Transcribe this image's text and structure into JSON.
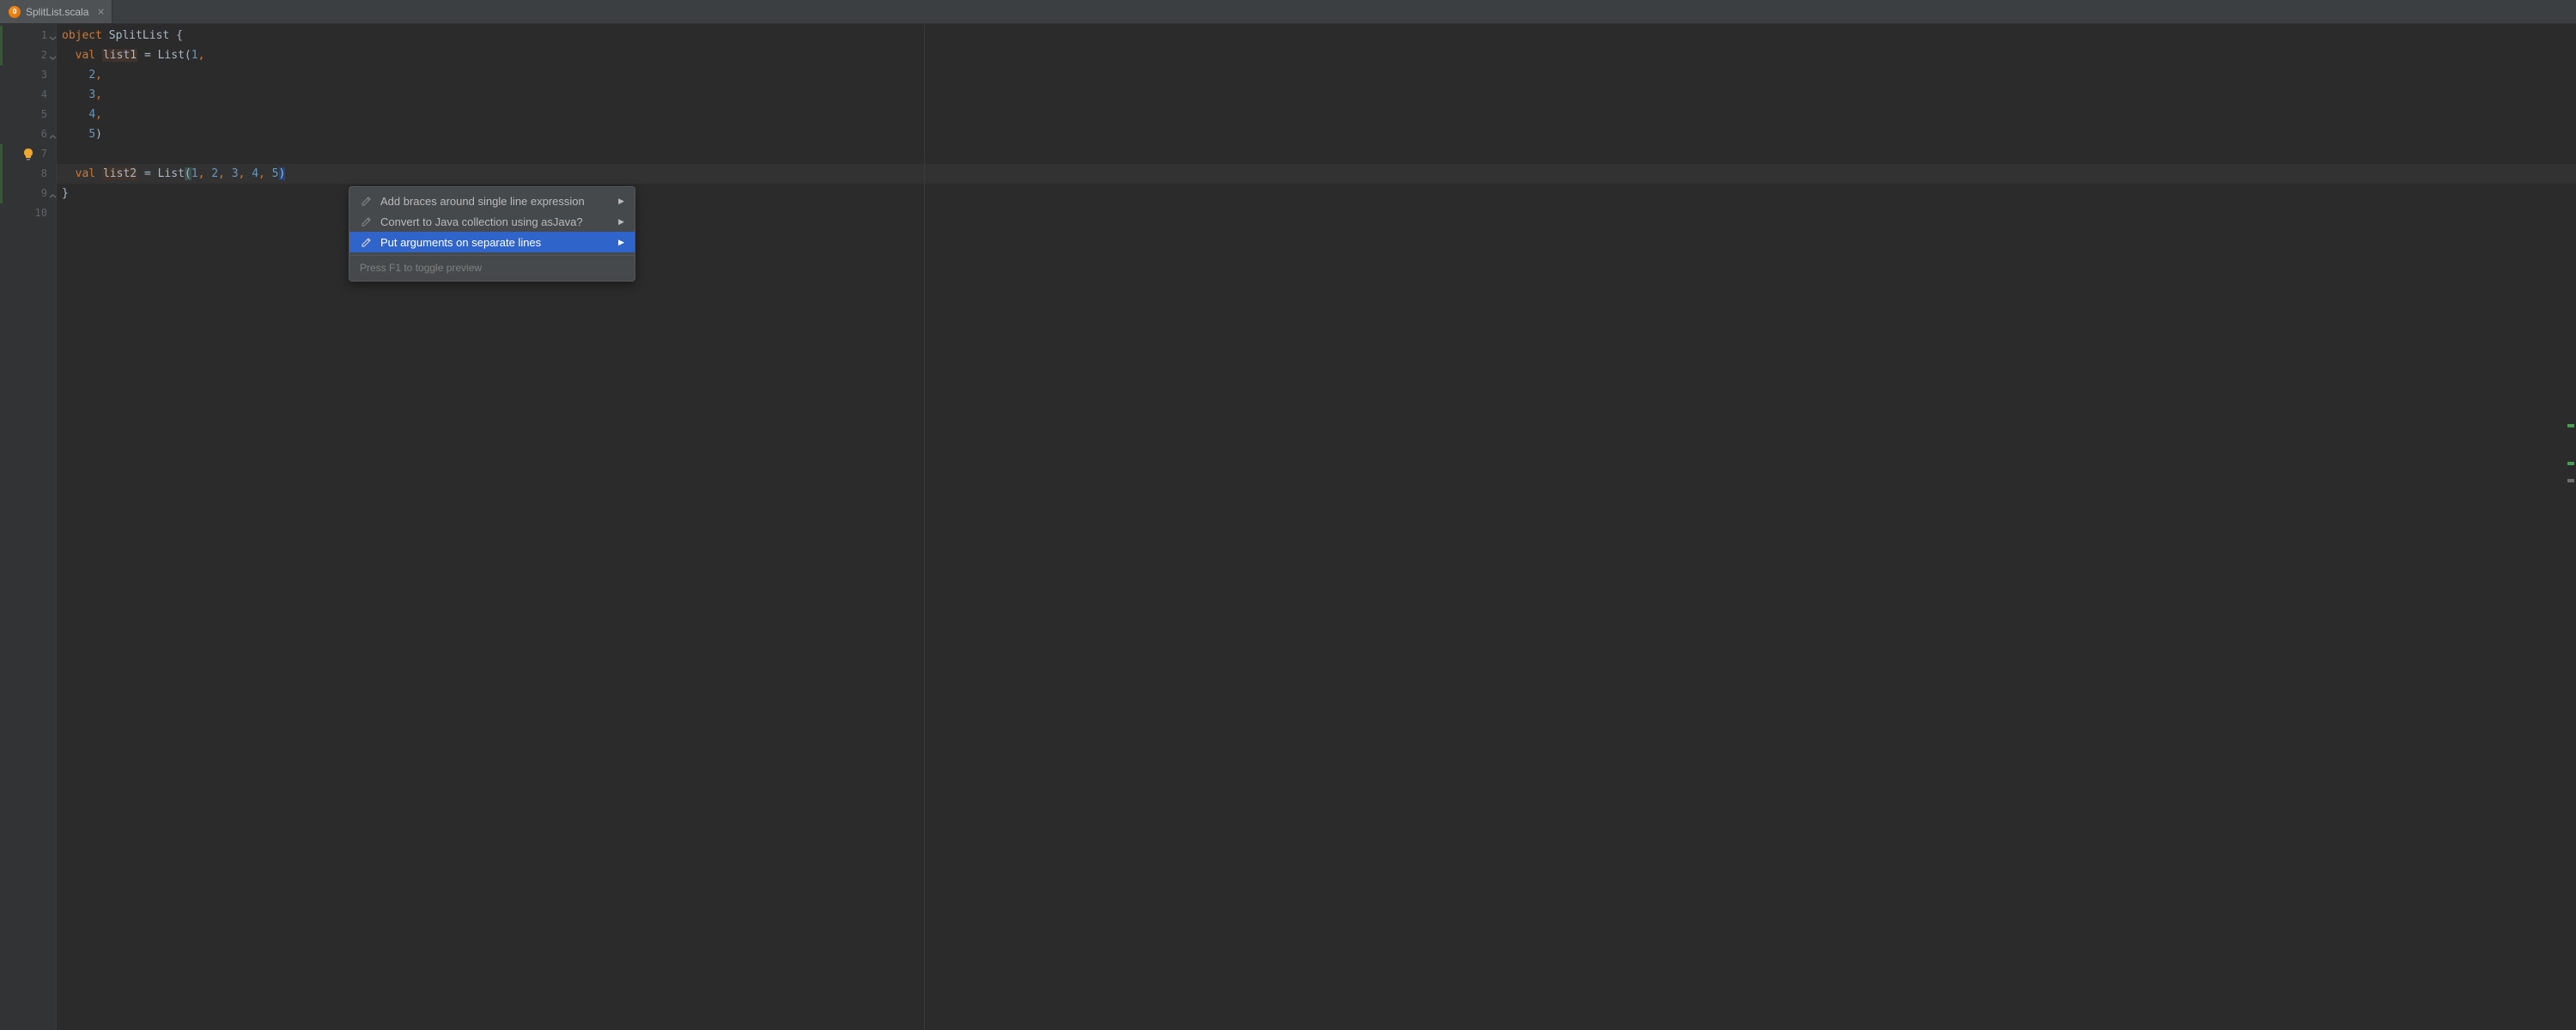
{
  "tab": {
    "filename": "SplitList.scala",
    "icon_letter": "O"
  },
  "gutter": {
    "line_numbers": [
      "1",
      "2",
      "3",
      "4",
      "5",
      "6",
      "7",
      "8",
      "9",
      "10"
    ]
  },
  "code": {
    "line1": {
      "kw1": "object",
      "name": "SplitList",
      "brace": "{"
    },
    "line2": {
      "kw": "val",
      "var": "list1",
      "eq": "=",
      "call": "List",
      "open": "(",
      "n": "1",
      "c": ","
    },
    "line3": {
      "n": "2",
      "c": ","
    },
    "line4": {
      "n": "3",
      "c": ","
    },
    "line5": {
      "n": "4",
      "c": ","
    },
    "line6": {
      "n": "5",
      "close": ")"
    },
    "line8": {
      "kw": "val",
      "var": "list2",
      "eq": "=",
      "call": "List",
      "open": "(",
      "v1": "1",
      "v2": "2",
      "v3": "3",
      "v4": "4",
      "v5": "5",
      "c": ",",
      "close": ")"
    },
    "line9": {
      "brace": "}"
    }
  },
  "menu": {
    "item1": "Add braces around single line expression",
    "item2": "Convert to Java collection using asJava?",
    "item3": "Put arguments on separate lines",
    "footer": "Press F1 to toggle preview"
  }
}
